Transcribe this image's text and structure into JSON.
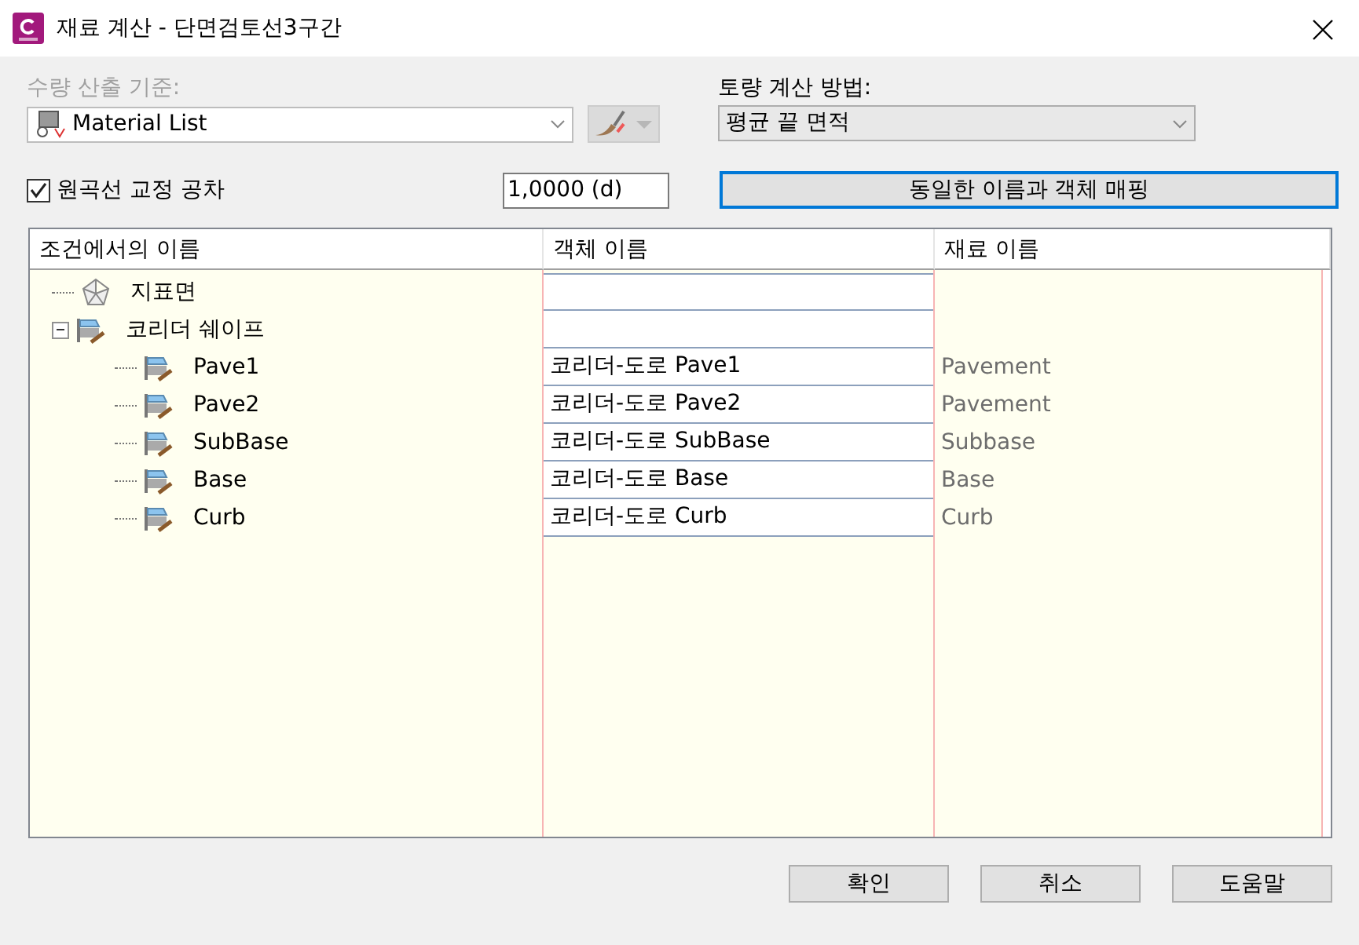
{
  "window": {
    "title": "재료 계산 - 단면검토선3구간"
  },
  "quantity_criteria": {
    "label": "수량 산출 기준:",
    "disabled": true,
    "value": "Material List"
  },
  "earthwork_method": {
    "label": "토량 계산 방법:",
    "value": "평균 끝 면적"
  },
  "curve_correction": {
    "label": "원곡선 교정 공차",
    "checked": true,
    "value": "1,0000 (d)"
  },
  "map_button": {
    "label": "동일한 이름과 객체 매핑",
    "focused": true
  },
  "table": {
    "columns": [
      "조건에서의 이름",
      "객체 이름",
      "재료 이름"
    ],
    "rows": [
      {
        "kind": "surface",
        "name": "지표면"
      },
      {
        "kind": "shape",
        "name": "코리더 쉐이프",
        "expanded": true,
        "children": [
          {
            "kind": "shape",
            "name": "Pave1",
            "object_name": "코리더-도로 Pave1",
            "material_name": "Pavement"
          },
          {
            "kind": "shape",
            "name": "Pave2",
            "object_name": "코리더-도로 Pave2",
            "material_name": "Pavement"
          },
          {
            "kind": "shape",
            "name": "SubBase",
            "object_name": "코리더-도로 SubBase",
            "material_name": "Subbase"
          },
          {
            "kind": "shape",
            "name": "Base",
            "object_name": "코리더-도로 Base",
            "material_name": "Base"
          },
          {
            "kind": "shape",
            "name": "Curb",
            "object_name": "코리더-도로 Curb",
            "material_name": "Curb"
          }
        ]
      }
    ]
  },
  "buttons": [
    "확인",
    "취소",
    "도움말"
  ]
}
